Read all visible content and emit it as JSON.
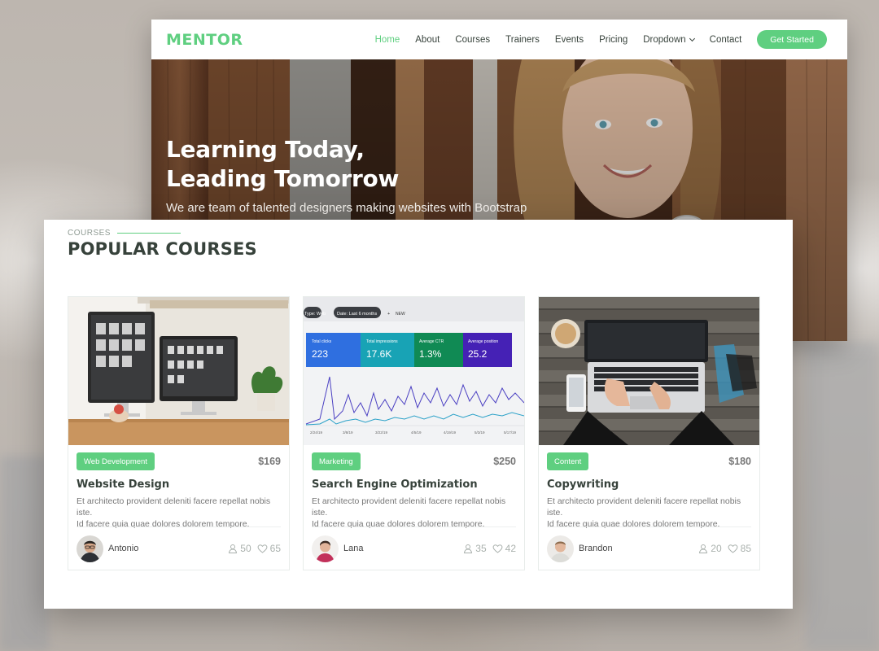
{
  "brand": {
    "name": "MENTOR",
    "accent": "#5fcf80",
    "text_dark": "#37423b"
  },
  "nav": {
    "items": [
      {
        "label": "Home",
        "active": true
      },
      {
        "label": "About"
      },
      {
        "label": "Courses"
      },
      {
        "label": "Trainers"
      },
      {
        "label": "Events"
      },
      {
        "label": "Pricing"
      },
      {
        "label": "Dropdown",
        "icon": "chevron-down-icon"
      },
      {
        "label": "Contact"
      }
    ],
    "cta": "Get Started"
  },
  "hero": {
    "title_line1": "Learning Today,",
    "title_line2": "Leading Tomorrow",
    "subtitle": "We are team of talented designers making websites with Bootstrap"
  },
  "section": {
    "tag": "COURSES",
    "title": "POPULAR COURSES"
  },
  "courses": [
    {
      "category": "Web Development",
      "price": "$169",
      "title": "Website Design",
      "description_line1": "Et architecto provident deleniti facere repellat nobis iste.",
      "description_line2": "Id facere quia quae dolores dolorem tempore.",
      "trainer": "Antonio",
      "students": "50",
      "likes": "65"
    },
    {
      "category": "Marketing",
      "price": "$250",
      "title": "Search Engine Optimization",
      "description_line1": "Et architecto provident deleniti facere repellat nobis iste.",
      "description_line2": "Id facere quia quae dolores dolorem tempore.",
      "trainer": "Lana",
      "students": "35",
      "likes": "42",
      "thumb_text": {
        "filter1": "Type: Web",
        "filter2": "Date: Last 6 months",
        "new_label": "NEW",
        "metrics": [
          {
            "label": "Total clicks",
            "value": "223"
          },
          {
            "label": "Total impressions",
            "value": "17.6K"
          },
          {
            "label": "Average CTR",
            "value": "1.3%"
          },
          {
            "label": "Average position",
            "value": "25.2"
          }
        ],
        "dates": [
          "2/24/19",
          "3/8/19",
          "3/22/19",
          "4/5/19",
          "4/19/19",
          "5/3/19",
          "5/17/19"
        ]
      }
    },
    {
      "category": "Content",
      "price": "$180",
      "title": "Copywriting",
      "description_line1": "Et architecto provident deleniti facere repellat nobis iste.",
      "description_line2": "Id facere quia quae dolores dolorem tempore.",
      "trainer": "Brandon",
      "students": "20",
      "likes": "85"
    }
  ],
  "icons": {
    "students": "user-icon",
    "likes": "heart-icon",
    "dropdown": "chevron-down-icon"
  }
}
